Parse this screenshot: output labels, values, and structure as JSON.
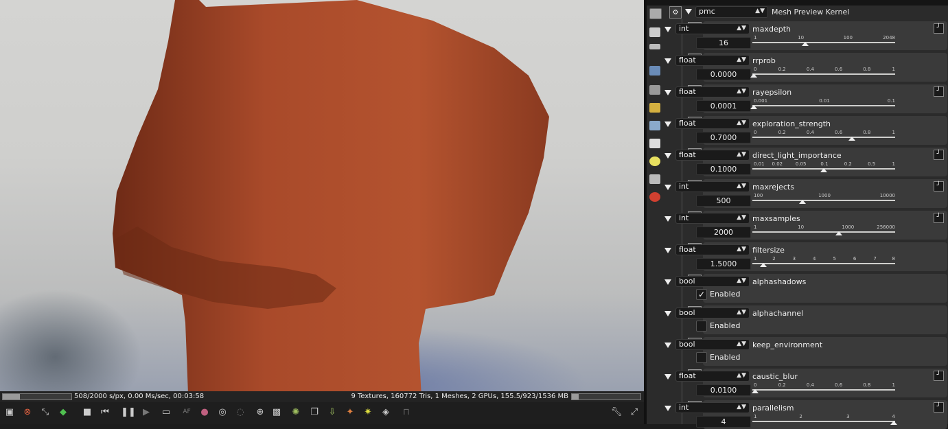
{
  "status": {
    "progress": 0.254,
    "left_text": "508/2000 s/px, 0.00 Ms/sec, 00:03:58",
    "right_text": "9 Textures, 160772 Tris, 1 Meshes, 2 GPUs, 155.5/923/1536 MB",
    "memory_fill": 0.1
  },
  "toolbar": {
    "icons": [
      "screen-icon",
      "clear-icon",
      "fit-icon",
      "cube-icon",
      "stop-icon",
      "restart-icon",
      "pause-icon",
      "play-icon",
      "monitor-icon",
      "af-icon",
      "material-icon",
      "picker-icon",
      "focus-icon",
      "zoom-icon",
      "region-icon",
      "refresh-icon",
      "copy-icon",
      "save-icon",
      "render-icon",
      "light-icon",
      "pick-icon",
      "lock-icon"
    ],
    "af_label": "AF",
    "right_icons": [
      "wrench-icon",
      "fullscreen-icon"
    ]
  },
  "panel": {
    "kernel_select": "pmc",
    "kernel_title": "Mesh Preview Kernel",
    "side_icons": [
      "kernel-icon",
      "layers-icon",
      "render-layers-icon",
      "image-icon",
      "camera-icon",
      "film-icon",
      "environment-icon",
      "imager-icon",
      "postproc-icon",
      "nodes-icon",
      "material-ball-icon"
    ],
    "params": [
      {
        "type": "int",
        "name": "maxdepth",
        "value": "16",
        "kind": "slider",
        "curve": true,
        "dot": "#d4a020",
        "ticks": [
          "1",
          "10",
          "100",
          "2048"
        ],
        "thumb": 0.37
      },
      {
        "type": "float",
        "name": "rrprob",
        "value": "0.0000",
        "kind": "slider",
        "curve": false,
        "dot": "#8fa1b8",
        "ticks": [
          "0",
          "0.2",
          "0.4",
          "0.6",
          "0.8",
          "1"
        ],
        "thumb": 0.0
      },
      {
        "type": "float",
        "name": "rayepsilon",
        "value": "0.0001",
        "kind": "slider",
        "curve": true,
        "dot": "#8fa1b8",
        "ticks": [
          "0.001",
          "0.01",
          "0.1"
        ],
        "thumb": 0.0
      },
      {
        "type": "float",
        "name": "exploration_strength",
        "value": "0.7000",
        "kind": "slider",
        "curve": false,
        "dot": "#8fa1b8",
        "ticks": [
          "0",
          "0.2",
          "0.4",
          "0.6",
          "0.8",
          "1"
        ],
        "thumb": 0.7
      },
      {
        "type": "float",
        "name": "direct_light_importance",
        "value": "0.1000",
        "kind": "slider",
        "curve": true,
        "dot": "#8fa1b8",
        "ticks": [
          "0.01",
          "0.02",
          "0.05",
          "0.1",
          "0.2",
          "0.5",
          "1"
        ],
        "thumb": 0.5
      },
      {
        "type": "int",
        "name": "maxrejects",
        "value": "500",
        "kind": "slider",
        "curve": true,
        "dot": "#d4a020",
        "ticks": [
          "100",
          "1000",
          "10000"
        ],
        "thumb": 0.35
      },
      {
        "type": "int",
        "name": "maxsamples",
        "value": "2000",
        "kind": "slider",
        "curve": true,
        "dot": "#d4a020",
        "ticks": [
          "1",
          "10",
          "1000",
          "256000"
        ],
        "thumb": 0.61
      },
      {
        "type": "float",
        "name": "filtersize",
        "value": "1.5000",
        "kind": "slider",
        "curve": false,
        "dot": "#8fa1b8",
        "ticks": [
          "1",
          "2",
          "3",
          "4",
          "5",
          "6",
          "7",
          "8"
        ],
        "thumb": 0.07
      },
      {
        "type": "bool",
        "name": "alphashadows",
        "value": "Enabled",
        "kind": "bool",
        "checked": true,
        "dot": "#b88fb8"
      },
      {
        "type": "bool",
        "name": "alphachannel",
        "value": "Enabled",
        "kind": "bool",
        "checked": false,
        "dot": "#b88fb8"
      },
      {
        "type": "bool",
        "name": "keep_environment",
        "value": "Enabled",
        "kind": "bool",
        "checked": false,
        "dot": "#b88fb8"
      },
      {
        "type": "float",
        "name": "caustic_blur",
        "value": "0.0100",
        "kind": "slider",
        "curve": true,
        "dot": "#8fa1b8",
        "ticks": [
          "0",
          "0.2",
          "0.4",
          "0.6",
          "0.8",
          "1"
        ],
        "thumb": 0.01
      },
      {
        "type": "int",
        "name": "parallelism",
        "value": "4",
        "kind": "slider",
        "curve": true,
        "dot": "#d4a020",
        "ticks": [
          "1",
          "2",
          "3",
          "4"
        ],
        "thumb": 1.0
      }
    ]
  }
}
